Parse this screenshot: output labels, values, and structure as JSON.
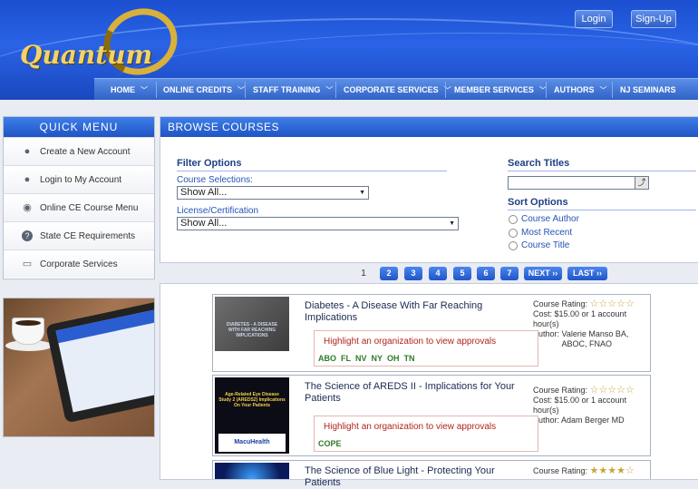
{
  "header": {
    "logo_text": "Quantum",
    "login_label": "Login",
    "signup_label": "Sign-Up"
  },
  "nav": {
    "items": [
      {
        "label": "HOME"
      },
      {
        "label": "ONLINE CREDITS"
      },
      {
        "label": "STAFF TRAINING"
      },
      {
        "label": "CORPORATE SERVICES"
      },
      {
        "label": "MEMBER SERVICES"
      },
      {
        "label": "AUTHORS"
      },
      {
        "label": "NJ SEMINARS"
      }
    ]
  },
  "quick_menu": {
    "title": "QUICK MENU",
    "items": [
      {
        "label": "Create a New Account",
        "icon": "user-icon"
      },
      {
        "label": "Login to My Account",
        "icon": "user-icon"
      },
      {
        "label": "Online CE Course Menu",
        "icon": "apple-icon"
      },
      {
        "label": "State CE Requirements",
        "icon": "question-icon"
      },
      {
        "label": "Corporate Services",
        "icon": "document-icon"
      }
    ]
  },
  "browse": {
    "title": "BROWSE COURSES",
    "filter_title": "Filter Options",
    "course_label": "Course Selections:",
    "course_value": "Show All...",
    "license_label": "License/Certification",
    "license_value": "Show All...",
    "search_title": "Search Titles",
    "sort_title": "Sort Options",
    "sort_options": [
      "Course Author",
      "Most Recent",
      "Course Title"
    ]
  },
  "pagination": {
    "current": "1",
    "pages": [
      "2",
      "3",
      "4",
      "5",
      "6",
      "7"
    ],
    "next_label": "NEXT ››",
    "last_label": "LAST ››"
  },
  "courses": [
    {
      "title": "Diabetes - A Disease With Far Reaching Implications",
      "thumb_text": "DIABETES - A DISEASE WITH FAR REACHING IMPLICATIONS",
      "rating_label": "Course Rating:",
      "rating": 0,
      "cost": "Cost: $15.00 or 1 account hour(s)",
      "author_label": "Author:",
      "author": "Valerie Manso BA, ABOC, FNAO",
      "approvals_text": "Highlight an organization to view approvals",
      "tags": [
        "ABO",
        "FL",
        "NV",
        "NY",
        "OH",
        "TN"
      ]
    },
    {
      "title": "The Science of AREDS II - Implications for Your Patients",
      "thumb_text": "Age-Related Eye Disease Study 2 (AREDS2) Implications On Your Patients",
      "thumb_brand": "MacuHealth",
      "rating_label": "Course Rating:",
      "rating": 0,
      "cost": "Cost: $15.00 or 1 account hour(s)",
      "author_label": "Author:",
      "author": "Adam Berger MD",
      "approvals_text": "Highlight an organization to view approvals",
      "tags": [
        "COPE"
      ]
    },
    {
      "title": "The Science of Blue Light - Protecting Your Patients",
      "rating_label": "Course Rating:",
      "rating": 4
    }
  ],
  "colors": {
    "header_blue": "#2a63e6",
    "accent_blue": "#1f54c4",
    "star_gold": "#c9a536",
    "approval_red": "#b2241a",
    "tag_green": "#2f7a2a"
  }
}
